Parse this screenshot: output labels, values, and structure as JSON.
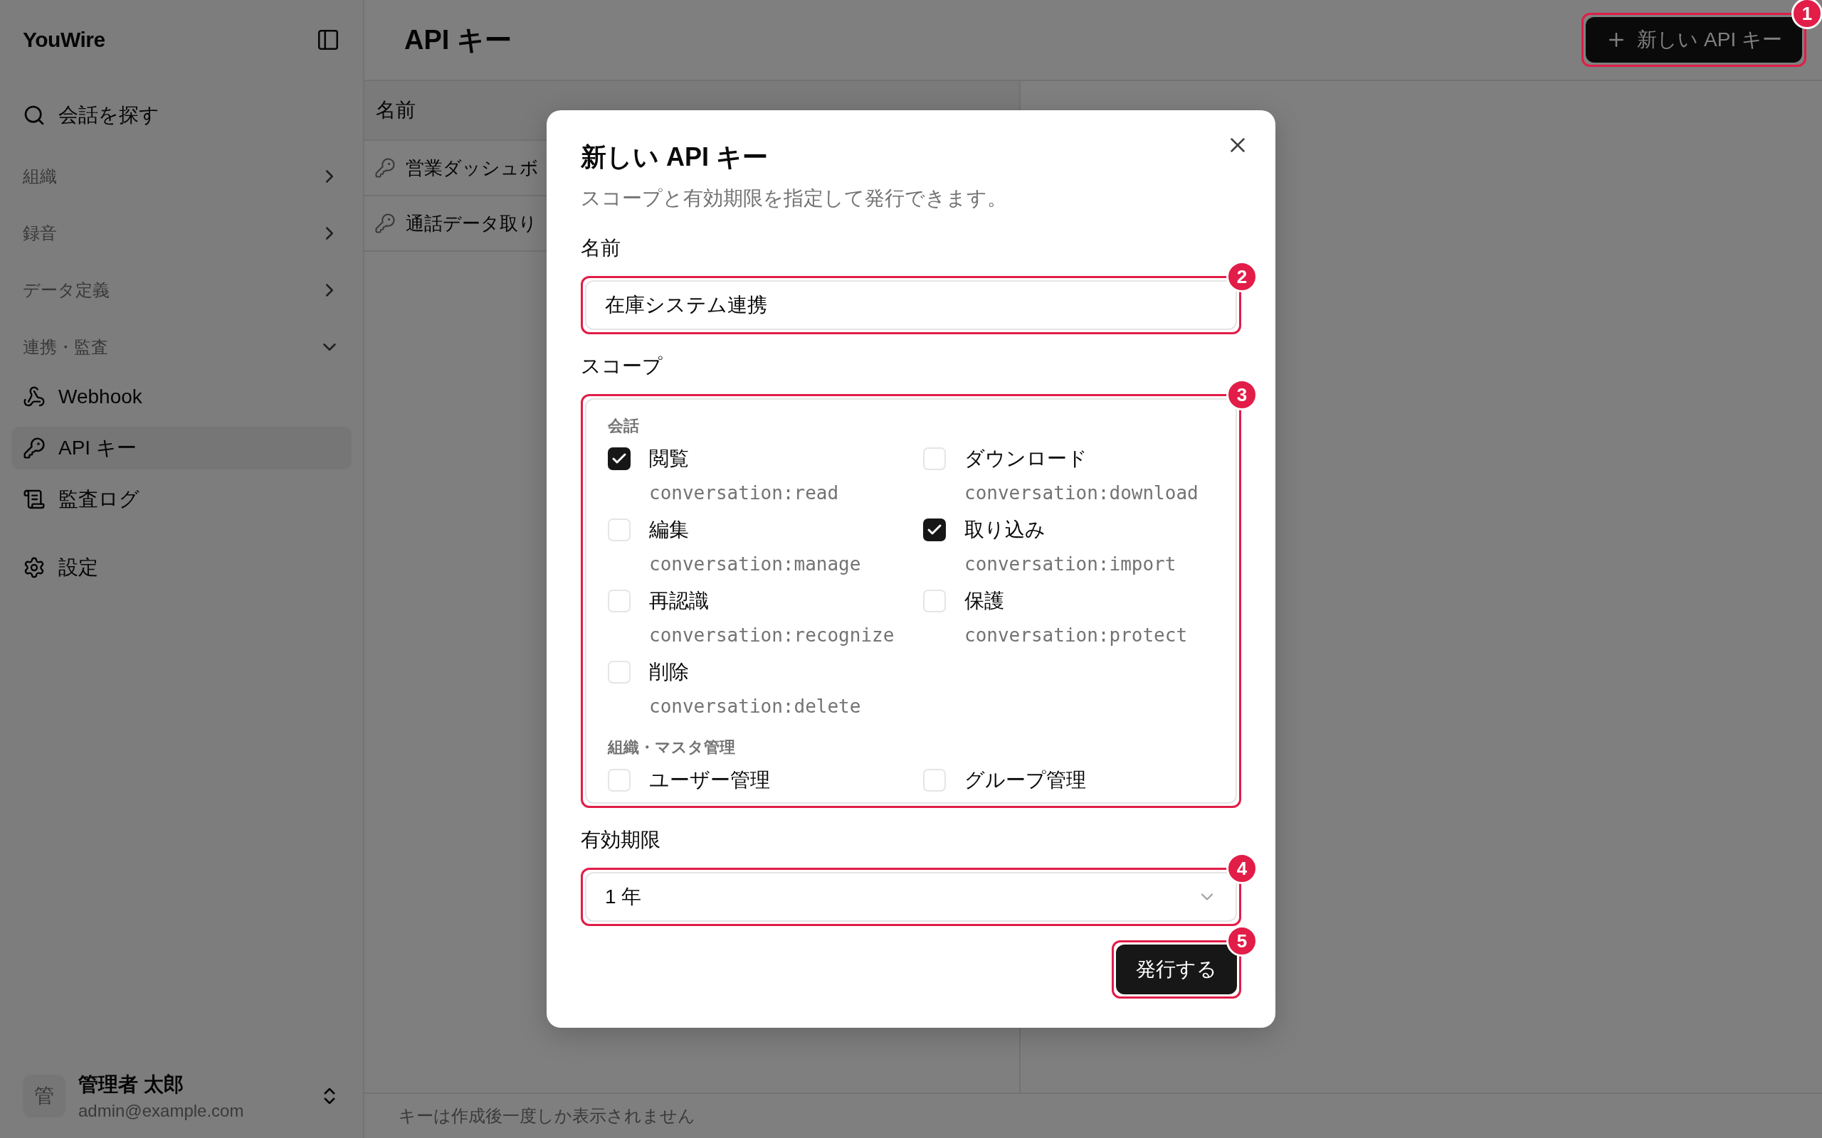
{
  "app": {
    "name": "YouWire"
  },
  "sidebar": {
    "search": "会話を探す",
    "groups": [
      {
        "label": "組織",
        "expanded": false
      },
      {
        "label": "録音",
        "expanded": false
      },
      {
        "label": "データ定義",
        "expanded": false
      },
      {
        "label": "連携・監査",
        "expanded": true,
        "items": [
          {
            "label": "Webhook",
            "selected": false
          },
          {
            "label": "API キー",
            "selected": true
          },
          {
            "label": "監査ログ",
            "selected": false
          }
        ]
      }
    ],
    "settings": "設定",
    "user": {
      "initial": "管",
      "name": "管理者 太郎",
      "email": "admin@example.com"
    }
  },
  "page": {
    "title": "API キー",
    "new_button": {
      "label": "新しい API キー",
      "badge": "1"
    },
    "table": {
      "columns": [
        "名前"
      ],
      "rows": [
        {
          "name": "営業ダッシュボ"
        },
        {
          "name": "通話データ取り"
        }
      ]
    },
    "footer_note": "キーは作成後一度しか表示されません"
  },
  "dialog": {
    "title": "新しい API キー",
    "description": "スコープと有効期限を指定して発行できます。",
    "name_field": {
      "label": "名前",
      "value": "在庫システム連携",
      "badge": "2"
    },
    "scope_field": {
      "label": "スコープ",
      "badge": "3",
      "groups": [
        {
          "label": "会話",
          "scopes": [
            {
              "label": "閲覧",
              "code": "conversation:read",
              "checked": true
            },
            {
              "label": "ダウンロード",
              "code": "conversation:download",
              "checked": false
            },
            {
              "label": "編集",
              "code": "conversation:manage",
              "checked": false
            },
            {
              "label": "取り込み",
              "code": "conversation:import",
              "checked": true
            },
            {
              "label": "再認識",
              "code": "conversation:recognize",
              "checked": false
            },
            {
              "label": "保護",
              "code": "conversation:protect",
              "checked": false
            },
            {
              "label": "削除",
              "code": "conversation:delete",
              "checked": false
            }
          ]
        },
        {
          "label": "組織・マスタ管理",
          "scopes": [
            {
              "label": "ユーザー管理",
              "checked": false
            },
            {
              "label": "グループ管理",
              "checked": false
            }
          ]
        }
      ]
    },
    "expiry_field": {
      "label": "有効期限",
      "value": "1 年",
      "badge": "4"
    },
    "submit": {
      "label": "発行する",
      "badge": "5"
    }
  }
}
